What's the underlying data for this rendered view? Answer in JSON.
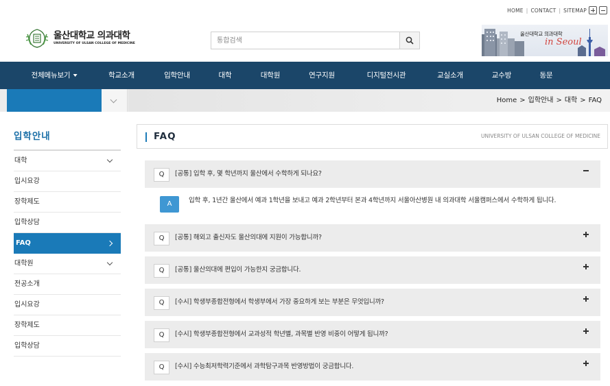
{
  "utility": {
    "home": "HOME",
    "contact": "CONTACT",
    "sitemap": "SITEMAP",
    "separator": "|"
  },
  "logo": {
    "korean": "울산대학교 의과대학",
    "english": "UNIVERSITY OF ULSAN COLLEGE OF MEDICINE"
  },
  "search": {
    "placeholder": "통합검색"
  },
  "banner": {
    "title": "울산대학교 의과대학",
    "script": "in Seoul"
  },
  "nav": {
    "items": [
      {
        "label": "전체메뉴보기"
      },
      {
        "label": "학교소개"
      },
      {
        "label": "입학안내"
      },
      {
        "label": "대학"
      },
      {
        "label": "대학원"
      },
      {
        "label": "연구지원"
      },
      {
        "label": "디지털전시관"
      },
      {
        "label": "교실소개"
      },
      {
        "label": "교수방"
      },
      {
        "label": "동문"
      }
    ]
  },
  "breadcrumb": {
    "items": [
      "Home",
      "입학안내",
      "대학",
      "FAQ"
    ],
    "separator": ">"
  },
  "sidebar": {
    "title": "입학안내",
    "items": [
      {
        "label": "대학"
      },
      {
        "label": "입시요강"
      },
      {
        "label": "장학제도"
      },
      {
        "label": "입학상담"
      },
      {
        "label": "FAQ"
      },
      {
        "label": "대학원"
      },
      {
        "label": "전공소개"
      },
      {
        "label": "입시요강"
      },
      {
        "label": "장학제도"
      },
      {
        "label": "입학상담"
      }
    ]
  },
  "content": {
    "title": "FAQ",
    "subtitle": "UNIVERSITY OF ULSAN COLLEGE OF MEDICINE",
    "q_label": "Q",
    "a_label": "A",
    "questions": [
      {
        "text": "[공통] 입학 후, 몇 학년까지 울산에서 수학하게 되나요?"
      },
      {
        "text": "[공통] 해외고 출신자도 울산의대에 지원이 가능합니까?"
      },
      {
        "text": "[공통] 울산의대에 편입이 가능한지 궁금합니다."
      },
      {
        "text": "[수시] 학생부종합전형에서 학생부에서 가장 중요하게 보는 부분은 무엇입니까?"
      },
      {
        "text": "[수시] 학생부종합전형에서 교과성적 학년별, 과목별 반영 비중이 어떻게 됩니까?"
      },
      {
        "text": "[수시] 수능최저학력기준에서 과학탐구과목 반영방법이 궁금합니다."
      }
    ],
    "answer": "입학 후, 1년간 울산에서 예과 1학년을 보내고 예과 2학년부터 본과 4학년까지 서울아산병원 내 의과대학 서울캠퍼스에서 수학하게 됩니다."
  },
  "colors": {
    "nav": "#1b4669",
    "accent": "#1a7ab8",
    "answer_badge": "#3f97d3",
    "question_bg": "#ececec"
  }
}
